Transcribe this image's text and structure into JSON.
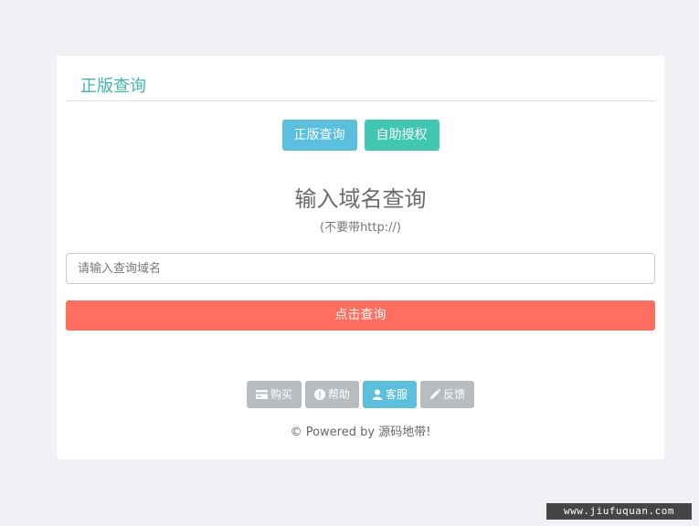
{
  "card": {
    "title": "正版查询"
  },
  "tabs": [
    {
      "label": "正版查询",
      "color": "#5bc0de"
    },
    {
      "label": "自助授权",
      "color": "#3fc7b2"
    }
  ],
  "main": {
    "heading": "输入域名查询",
    "subheading": "(不要带http://)",
    "input_placeholder": "请输入查询域名",
    "input_value": "",
    "submit_label": "点击查询",
    "submit_color": "#ff6e5f"
  },
  "footer": {
    "buttons": [
      {
        "label": "购买",
        "icon": "credit-card-icon"
      },
      {
        "label": "帮助",
        "icon": "exclamation-circle-icon"
      },
      {
        "label": "客服",
        "icon": "user-icon",
        "active": true
      },
      {
        "label": "反馈",
        "icon": "pencil-icon"
      }
    ],
    "copyright_prefix": "© Powered by ",
    "copyright_brand": "源码地带!"
  },
  "watermark": "www.jiufuquan.com"
}
